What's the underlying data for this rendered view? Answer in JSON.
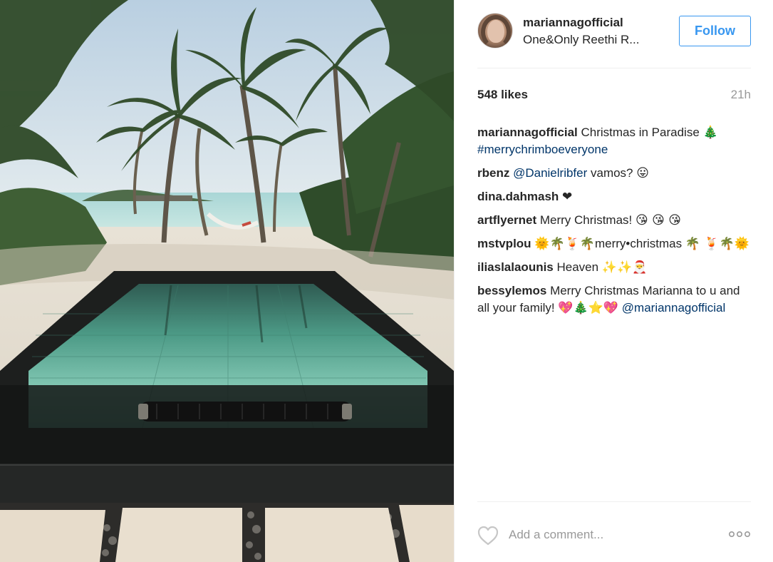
{
  "post": {
    "image": {
      "alt": "",
      "subject": "photo"
    },
    "header": {
      "username": "mariannagofficial",
      "location": "One&Only Reethi R...",
      "follow_label": "Follow",
      "avatar_icon": "profile-photo"
    },
    "stats": {
      "likes": "548 likes",
      "time": "21h"
    },
    "comments": [
      {
        "user": "mariannagofficial",
        "parts": [
          {
            "t": "text",
            "v": " Christmas in Paradise "
          },
          {
            "t": "emoji",
            "v": "🎄"
          },
          {
            "t": "link",
            "v": "#merrychrimboeveryone"
          }
        ]
      },
      {
        "user": "rbenz",
        "parts": [
          {
            "t": "text",
            "v": " "
          },
          {
            "t": "link",
            "v": "@Danielribfer"
          },
          {
            "t": "text",
            "v": " vamos? "
          },
          {
            "t": "emoji",
            "v": "😛"
          }
        ]
      },
      {
        "user": "dina.dahmash",
        "parts": [
          {
            "t": "text",
            "v": " "
          },
          {
            "t": "emoji",
            "v": "❤"
          }
        ]
      },
      {
        "user": "artflyernet",
        "parts": [
          {
            "t": "text",
            "v": " Merry Christmas! "
          },
          {
            "t": "emoji",
            "v": "😘 😘 😘"
          }
        ]
      },
      {
        "user": "mstvplou",
        "parts": [
          {
            "t": "text",
            "v": " "
          },
          {
            "t": "emoji",
            "v": "🌞🌴🍹🌴"
          },
          {
            "t": "text",
            "v": "merry•christmas "
          },
          {
            "t": "emoji",
            "v": "🌴 🍹🌴🌞"
          }
        ]
      },
      {
        "user": "iliaslalaounis",
        "parts": [
          {
            "t": "text",
            "v": " Heaven "
          },
          {
            "t": "emoji",
            "v": "✨✨🎅"
          }
        ]
      },
      {
        "user": "bessylemos",
        "parts": [
          {
            "t": "text",
            "v": " Merry Christmas Marianna to u and all your family! "
          },
          {
            "t": "emoji",
            "v": "💖🎄⭐💖"
          },
          {
            "t": "text",
            "v": " "
          },
          {
            "t": "link",
            "v": "@mariannagofficial"
          }
        ]
      }
    ],
    "footer": {
      "like_icon": "heart-outline-icon",
      "comment_placeholder": "Add a comment...",
      "more_icon": "more-options-icon"
    },
    "colors": {
      "accent": "#3897f0",
      "link": "#003569",
      "muted": "#999999",
      "text": "#262626",
      "divider": "#efefef"
    }
  }
}
